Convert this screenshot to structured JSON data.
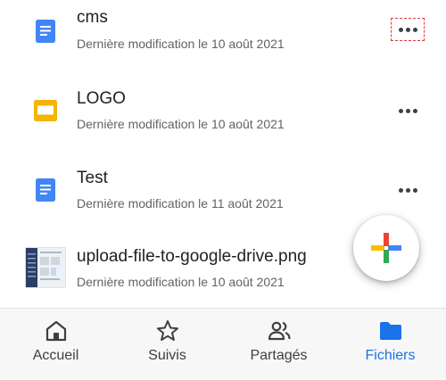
{
  "files": [
    {
      "name": "cms",
      "modified": "Dernière modification le 10 août 2021",
      "type_icon": "docs-icon",
      "menu_icon": "more-horizontal-icon"
    },
    {
      "name": "LOGO",
      "modified": "Dernière modification le 10 août 2021",
      "type_icon": "slides-icon",
      "menu_icon": "more-horizontal-icon"
    },
    {
      "name": "Test",
      "modified": "Dernière modification le 11 août 2021",
      "type_icon": "docs-icon",
      "menu_icon": "more-horizontal-icon"
    },
    {
      "name": "upload-file-to-google-drive.png",
      "modified": "Dernière modification le 10 août 2021",
      "type_icon": "image-thumbnail",
      "menu_icon": "more-horizontal-icon"
    }
  ],
  "fab": {
    "icon": "plus-icon",
    "colors": [
      "#ea4335",
      "#fbbc04",
      "#34a853",
      "#4285f4"
    ]
  },
  "nav": {
    "items": [
      {
        "label": "Accueil",
        "icon": "home-icon"
      },
      {
        "label": "Suivis",
        "icon": "star-icon"
      },
      {
        "label": "Partagés",
        "icon": "people-icon"
      },
      {
        "label": "Fichiers",
        "icon": "folder-icon"
      }
    ],
    "active": "Fichiers"
  },
  "colors": {
    "accent": "#1a73e8",
    "docs": "#4285f4",
    "slides": "#f4b400",
    "highlight": "#e53935"
  }
}
